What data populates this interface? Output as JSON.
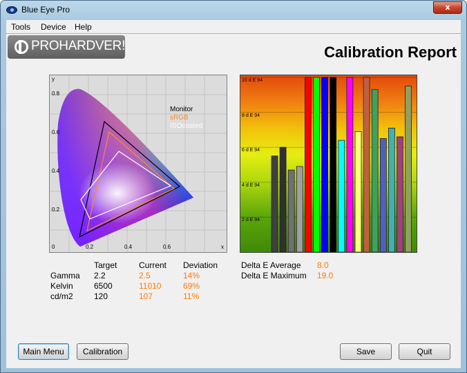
{
  "window": {
    "title": "Blue Eye Pro",
    "close_label": "x"
  },
  "menu": {
    "items": [
      "Tools",
      "Device",
      "Help"
    ]
  },
  "logo": {
    "text": "PROHARDVER!"
  },
  "report": {
    "title": "Calibration Report"
  },
  "cie_chart": {
    "y_axis_letter": "y",
    "x_axis_letter": "x",
    "y_ticks": [
      "0.8",
      "0.6",
      "0.4",
      "0.2",
      "0"
    ],
    "x_ticks": [
      "0.2",
      "0.4",
      "0.6"
    ],
    "legend": {
      "monitor": "Monitor",
      "srgb": "sRGB",
      "iso": "ISOcoated"
    },
    "colors": {
      "monitor": "#000000",
      "srgb": "#ff8a20",
      "iso": "#ffffff"
    }
  },
  "chart_data": {
    "type": "bar",
    "ylabel": "d E 94",
    "ylim": [
      0,
      10
    ],
    "y_ticks": [
      "10 d E 94",
      "8 d E 94",
      "6 d E 94",
      "4 d E 94",
      "2 d E 94"
    ],
    "values": [
      5.5,
      6.0,
      4.7,
      4.9,
      10.0,
      10.0,
      10.0,
      10.0,
      6.4,
      10.0,
      6.9,
      10.0,
      9.3,
      6.5,
      7.1,
      6.6,
      9.5
    ],
    "colors": [
      "#404040",
      "#303030",
      "#707070",
      "#a0a0a0",
      "#ff0000",
      "#00ff00",
      "#0000ff",
      "#000000",
      "#00ffff",
      "#ff00ff",
      "#ffff80",
      "#c06040",
      "#40a060",
      "#5060c0",
      "#40b0b0",
      "#a04080",
      "#90a060"
    ]
  },
  "stats": {
    "headers": {
      "target": "Target",
      "current": "Current",
      "deviation": "Deviation"
    },
    "rows": [
      {
        "label": "Gamma",
        "target": "2.2",
        "current": "2.5",
        "deviation": "14%"
      },
      {
        "label": "Kelvin",
        "target": "6500",
        "current": "11010",
        "deviation": "69%"
      },
      {
        "label": "cd/m2",
        "target": "120",
        "current": "107",
        "deviation": "11%"
      }
    ],
    "delta_e": [
      {
        "label": "Delta E Average",
        "value": "8.0"
      },
      {
        "label": "Delta E Maximum",
        "value": "19.0"
      }
    ]
  },
  "buttons": {
    "main_menu": "Main Menu",
    "calibration": "Calibration",
    "save": "Save",
    "quit": "Quit"
  }
}
